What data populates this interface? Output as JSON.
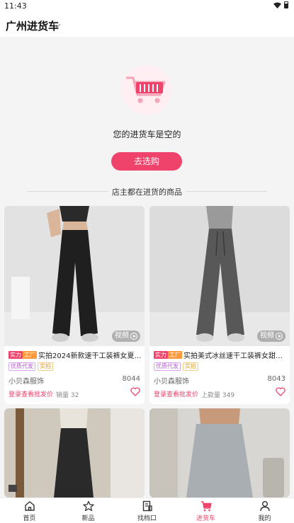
{
  "status_bar": {
    "time": "11:43"
  },
  "header": {
    "title": "广州进货车"
  },
  "empty_state": {
    "message": "您的进货车是空的",
    "button_label": "去选购"
  },
  "section": {
    "title": "店主都在进货的商品"
  },
  "products": [
    {
      "badge_strong": "实力",
      "badge_factory": "工厂",
      "title": "实拍2024新款速干工装裤女夏美式…",
      "tags": [
        "优质代发",
        "实拍"
      ],
      "shop": "小贝森服饰",
      "code": "8044",
      "login_text": "登录查看批发价",
      "metric": "销量 32",
      "video_label": "视频",
      "pants_color": "#1f1f1f"
    },
    {
      "badge_strong": "实力",
      "badge_factory": "工厂",
      "title": "实拍美式冰丝速干工装裤女甜酷辣…",
      "tags": [
        "优质代发",
        "实拍"
      ],
      "shop": "小贝森服饰",
      "code": "8043",
      "login_text": "登录查看批发价",
      "metric": "上款量 349",
      "video_label": "视频",
      "pants_color": "#585858"
    }
  ],
  "tabs": [
    {
      "label": "首页",
      "icon": "home-icon"
    },
    {
      "label": "新品",
      "icon": "star-icon"
    },
    {
      "label": "找档口",
      "icon": "store-icon"
    },
    {
      "label": "进货车",
      "icon": "cart-icon",
      "active": true
    },
    {
      "label": "我的",
      "icon": "user-icon"
    }
  ],
  "colors": {
    "accent": "#f0436b"
  }
}
